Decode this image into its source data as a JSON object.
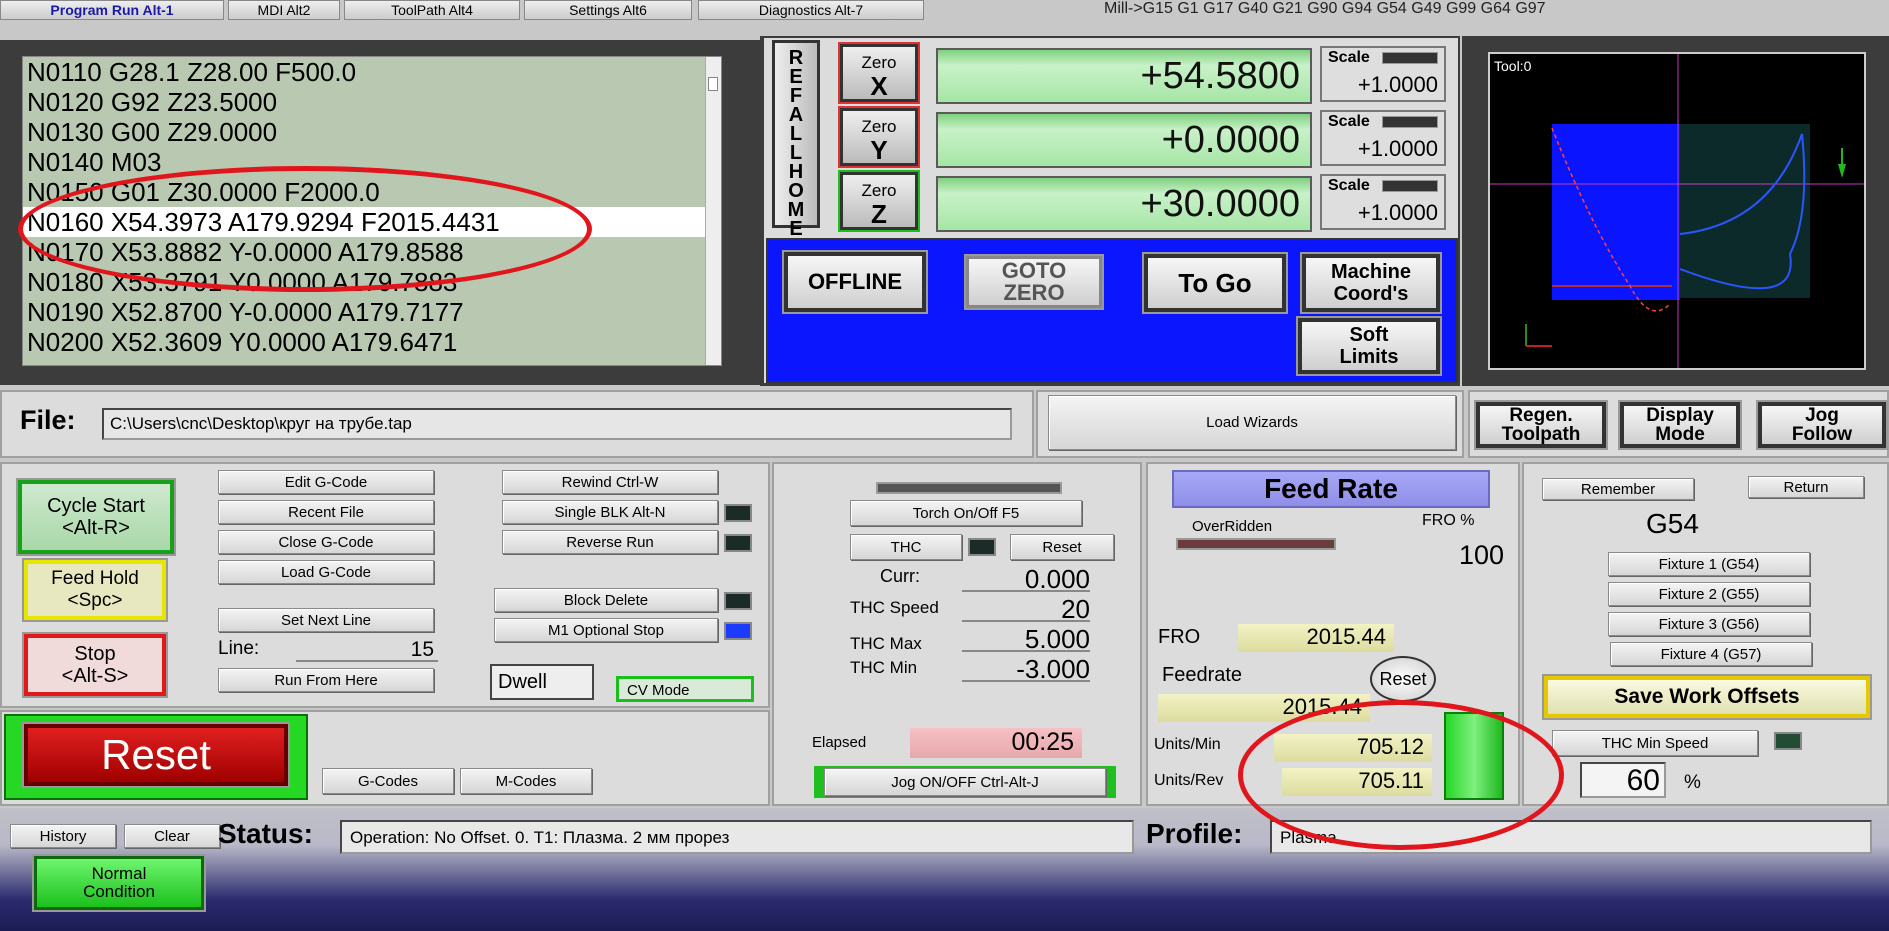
{
  "tabs": [
    "Program Run Alt-1",
    "MDI Alt2",
    "ToolPath Alt4",
    "Settings Alt6",
    "Diagnostics Alt-7"
  ],
  "modal_line": "Mill->G15  G1 G17 G40 G21 G90 G94 G54 G49 G99 G64 G97",
  "gcode_lines": [
    "N0110 G28.1 Z28.00 F500.0",
    "N0120 G92 Z23.5000",
    "N0130 G00 Z29.0000",
    "N0140 M03",
    "N0150 G01 Z30.0000 F2000.0",
    "N0160 X54.3973 A179.9294 F2015.4431",
    "N0170 X53.8882 Y-0.0000 A179.8588",
    "N0180 X53.3791 Y0.0000 A179.7883",
    "N0190 X52.8700 Y-0.0000 A179.7177",
    "N0200 X52.3609 Y0.0000 A179.6471"
  ],
  "current_line_index": 5,
  "dro": {
    "ref_all_home": "REF ALL HOME",
    "axes": [
      {
        "zero_label": "Zero",
        "axis": "X",
        "value": "+54.5800",
        "scale_label": "Scale",
        "scale": "+1.0000"
      },
      {
        "zero_label": "Zero",
        "axis": "Y",
        "value": "+0.0000",
        "scale_label": "Scale",
        "scale": "+1.0000"
      },
      {
        "zero_label": "Zero",
        "axis": "Z",
        "value": "+30.0000",
        "scale_label": "Scale",
        "scale": "+1.0000"
      }
    ],
    "offline": "OFFLINE",
    "goto_zero": "GOTO ZERO",
    "to_go": "To Go",
    "machine_coords_1": "Machine",
    "machine_coords_2": "Coord's",
    "soft_limits_1": "Soft",
    "soft_limits_2": "Limits"
  },
  "toolpath": {
    "tool_label": "Tool:0"
  },
  "file": {
    "label": "File:",
    "path": "C:\\Users\\cnc\\Desktop\\круг на трубе.tap",
    "load_wizards": "Load Wizards"
  },
  "view_buttons": {
    "regen_1": "Regen.",
    "regen_2": "Toolpath",
    "display_1": "Display",
    "display_2": "Mode",
    "jog_1": "Jog",
    "jog_2": "Follow"
  },
  "program_controls": {
    "cycle_start_1": "Cycle Start",
    "cycle_start_2": "<Alt-R>",
    "feed_hold_1": "Feed Hold",
    "feed_hold_2": "<Spc>",
    "stop_1": "Stop",
    "stop_2": "<Alt-S>",
    "edit_gcode": "Edit G-Code",
    "recent_file": "Recent File",
    "close_gcode": "Close G-Code",
    "load_gcode": "Load G-Code",
    "set_next_line": "Set Next Line",
    "line_label": "Line:",
    "line_value": "15",
    "run_from_here": "Run From Here",
    "rewind": "Rewind Ctrl-W",
    "single_blk": "Single BLK Alt-N",
    "reverse_run": "Reverse Run",
    "block_delete": "Block Delete",
    "m1_optional_stop": "M1 Optional Stop",
    "dwell": "Dwell",
    "cv_mode": "CV Mode"
  },
  "reset_area": {
    "reset": "Reset",
    "gcodes": "G-Codes",
    "mcodes": "M-Codes"
  },
  "thc": {
    "torch": "Torch On/Off F5",
    "thc_btn": "THC",
    "reset": "Reset",
    "curr_label": "Curr:",
    "curr_value": "0.000",
    "speed_label": "THC Speed",
    "speed_value": "20",
    "max_label": "THC Max",
    "max_value": "5.000",
    "min_label": "THC Min",
    "min_value": "-3.000",
    "elapsed_label": "Elapsed",
    "elapsed_value": "00:25",
    "jog": "Jog ON/OFF Ctrl-Alt-J"
  },
  "feed": {
    "title": "Feed Rate",
    "overridden": "OverRidden",
    "fro_pct_label": "FRO %",
    "fro_pct_value": "100",
    "fro_label": "FRO",
    "fro_value": "2015.44",
    "feedrate_label": "Feedrate",
    "feedrate_value": "2015.44",
    "reset": "Reset",
    "units_min_label": "Units/Min",
    "units_min_value": "705.12",
    "units_rev_label": "Units/Rev",
    "units_rev_value": "705.11"
  },
  "offsets": {
    "remember": "Remember",
    "return": "Return",
    "current": "G54",
    "fixture1": "Fixture 1 (G54)",
    "fixture2": "Fixture 2 (G55)",
    "fixture3": "Fixture 3 (G56)",
    "fixture4": "Fixture 4 (G57)",
    "save": "Save Work Offsets",
    "thc_min_speed": "THC Min Speed",
    "thc_min_value": "60",
    "pct": "%"
  },
  "status_bar": {
    "history": "History",
    "clear": "Clear",
    "status_label": "Status:",
    "status_text": "Operation: No Offset. 0. T1: Плазма. 2 мм прорез",
    "profile_label": "Profile:",
    "profile_value": "Plasma",
    "normal_1": "Normal",
    "normal_2": "Condition"
  },
  "colors": {
    "dro_bg": "#0b16ff",
    "annotation": "#e0161c",
    "gcode_bg": "#b9c8b1"
  }
}
